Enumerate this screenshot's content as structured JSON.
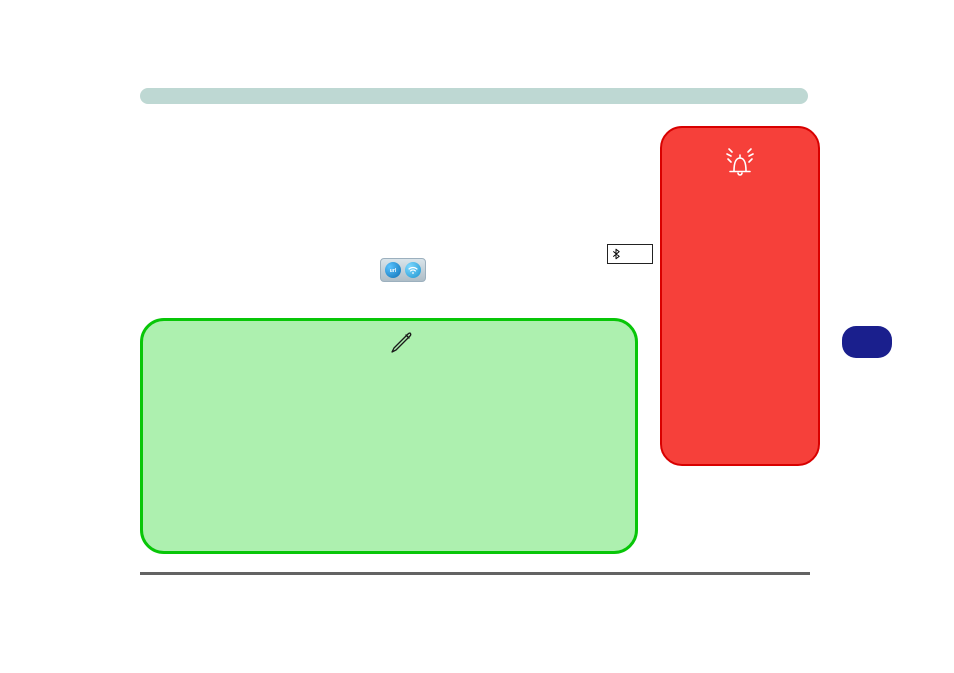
{
  "colors": {
    "topBar": "#BED8D3",
    "redPanelFill": "#F6403A",
    "redPanelBorder": "#D80000",
    "greenPanelFill": "#ADF0AF",
    "greenPanelBorder": "#08C608",
    "bluePill": "#1A1F8D",
    "bottomRule": "#636363"
  },
  "icons": {
    "alarm": "alarm-bell-icon",
    "pen": "pen-icon",
    "wifi": "wifi-icon",
    "bluetooth": "bluetooth-icon"
  }
}
